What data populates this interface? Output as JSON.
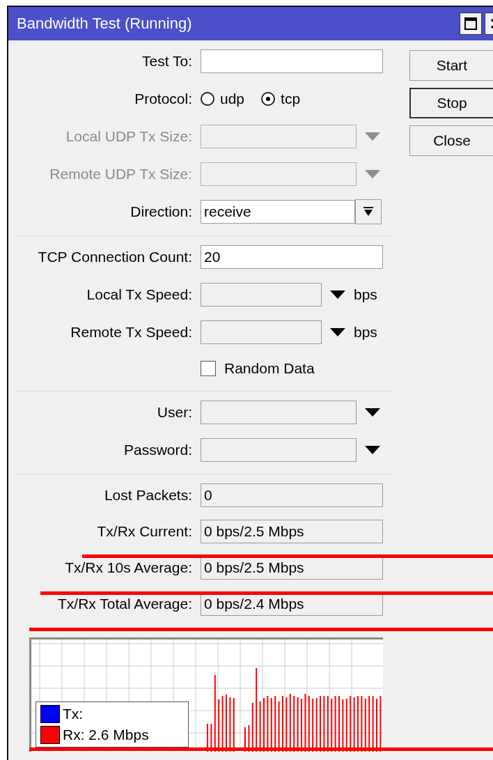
{
  "window": {
    "title": "Bandwidth Test (Running)"
  },
  "buttons": [
    {
      "label": "Start",
      "focused": false
    },
    {
      "label": "Stop",
      "focused": true
    },
    {
      "label": "Close",
      "focused": false
    }
  ],
  "sections": [
    {
      "rows": [
        {
          "kind": "text",
          "label": "Test To:"
        },
        {
          "kind": "radio",
          "label": "Protocol:",
          "options": [
            {
              "label": "udp",
              "selected": false
            },
            {
              "label": "tcp",
              "selected": true
            }
          ]
        },
        {
          "kind": "combo",
          "label": "Local UDP Tx Size:",
          "disabled": true
        },
        {
          "kind": "combo",
          "label": "Remote UDP Tx Size:",
          "disabled": true
        },
        {
          "kind": "select",
          "label": "Direction:",
          "value": "receive"
        }
      ]
    },
    {
      "rows": [
        {
          "kind": "text",
          "label": "TCP Connection Count:",
          "value": "20"
        },
        {
          "kind": "speed",
          "label": "Local Tx Speed:",
          "unit": "bps"
        },
        {
          "kind": "speed",
          "label": "Remote Tx Speed:",
          "unit": "bps"
        },
        {
          "kind": "checkbox",
          "label": "Random Data",
          "checked": false
        }
      ]
    },
    {
      "rows": [
        {
          "kind": "combo",
          "label": "User:",
          "disabled": false
        },
        {
          "kind": "combo",
          "label": "Password:",
          "disabled": false
        }
      ]
    },
    {
      "rows": [
        {
          "kind": "readonly",
          "label": "Lost Packets:",
          "value": "0"
        },
        {
          "kind": "readonly",
          "label": "Tx/Rx Current:",
          "value": "0 bps/2.5 Mbps"
        },
        {
          "kind": "readonly",
          "label": "Tx/Rx 10s Average:",
          "value": "0 bps/2.5 Mbps"
        },
        {
          "kind": "readonly",
          "label": "Tx/Rx Total Average:",
          "value": "0 bps/2.4 Mbps"
        }
      ]
    }
  ],
  "graph": {
    "legend": [
      {
        "label": "Tx:",
        "color": "#0000ff"
      },
      {
        "label": "Rx:  2.6 Mbps",
        "color": "#ff0000"
      }
    ]
  }
}
